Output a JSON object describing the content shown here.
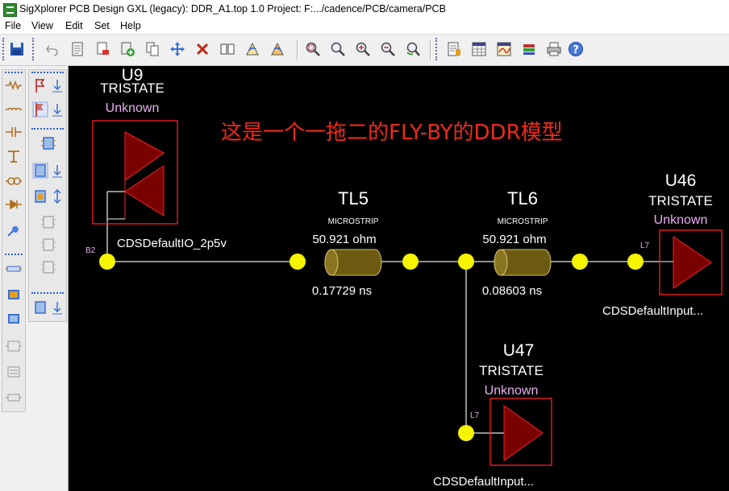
{
  "window": {
    "title": "SigXplorer PCB Design GXL (legacy): DDR_A1.top 1.0  Project: F:.../cadence/PCB/camera/PCB"
  },
  "menu": [
    {
      "label": "File"
    },
    {
      "label": "View"
    },
    {
      "label": "Edit"
    },
    {
      "label": "Set"
    },
    {
      "label": "Help"
    }
  ],
  "toolbar_icons": [
    "save-icon",
    "undo-icon",
    "new-sheet-icon",
    "erase-icon",
    "add-part-icon",
    "copy-icon",
    "move-icon",
    "delete-icon",
    "mirror-icon",
    "rotate-left-icon",
    "rotate-right-icon",
    "zoom-fit-icon",
    "zoom-window-icon",
    "zoom-in-icon",
    "zoom-out-icon",
    "zoom-previous-icon",
    "parameters-icon",
    "spreadsheet-icon",
    "analyze-icon",
    "measurement-icon",
    "print-icon",
    "help-icon"
  ],
  "palette_icons": [
    "resistor-icon",
    "inductor-icon",
    "capacitor-icon",
    "terminator-icon",
    "transformer-icon",
    "diode-icon",
    "probe-icon",
    "connector-icon",
    "ic-block-icon",
    "pin-icon",
    "via-icon",
    "cable-icon"
  ],
  "palette2_icons": [
    "flag-icon",
    "flag-hatched-icon",
    "cpu-icon",
    "chip-down-icon",
    "chip-updown-icon",
    "package-icon",
    "package-2-icon",
    "package-3-icon",
    "package-down-icon"
  ],
  "colors": {
    "wire": "#c0c0c0",
    "node": "#f5f500",
    "driver_fill": "#7a0000",
    "driver_outline": "#ff2020",
    "tline": "#6b5a10",
    "model_status": "#e8b0f0",
    "annotation": "#ee2a1a"
  },
  "annotation": "这是一个一拖二的FLY-BY的DDR模型",
  "parts": {
    "u9": {
      "refdes": "U9",
      "mode": "TRISTATE",
      "status": "Unknown",
      "pin": "B2",
      "model": "CDSDefaultIO_2p5v"
    },
    "u46": {
      "refdes": "U46",
      "mode": "TRISTATE",
      "status": "Unknown",
      "pin": "L7",
      "model": "CDSDefaultInput..."
    },
    "u47": {
      "refdes": "U47",
      "mode": "TRISTATE",
      "status": "Unknown",
      "pin": "L7",
      "model": "CDSDefaultInput..."
    }
  },
  "tlines": {
    "tl5": {
      "name": "TL5",
      "type": "MICROSTRIP",
      "impedance": "50.921 ohm",
      "delay": "0.17729 ns"
    },
    "tl6": {
      "name": "TL6",
      "type": "MICROSTRIP",
      "impedance": "50.921 ohm",
      "delay": "0.08603 ns"
    }
  }
}
